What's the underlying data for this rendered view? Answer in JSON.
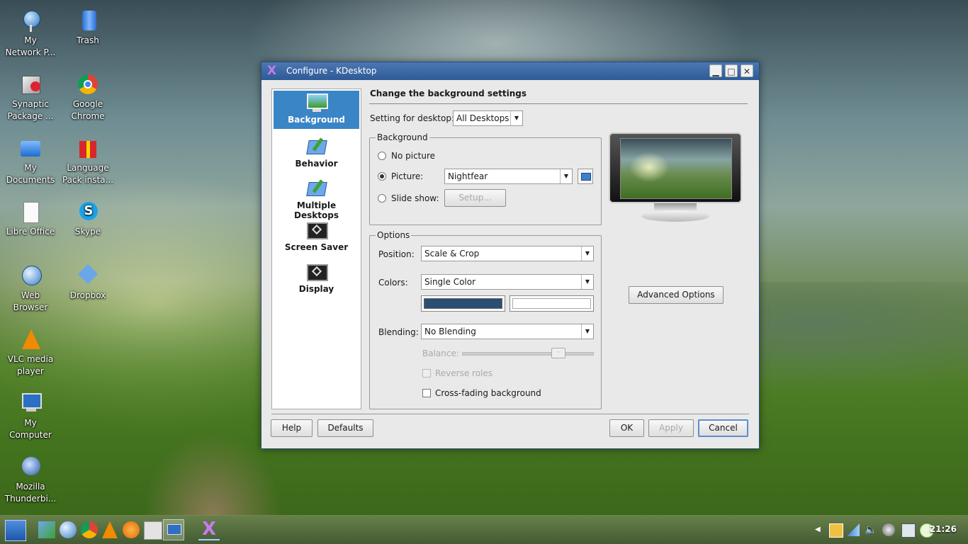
{
  "desktop": {
    "icons": [
      {
        "label1": "My",
        "label2": "Network P..."
      },
      {
        "label1": "Trash",
        "label2": ""
      },
      {
        "label1": "Synaptic",
        "label2": "Package ..."
      },
      {
        "label1": "Google",
        "label2": "Chrome"
      },
      {
        "label1": "My",
        "label2": "Documents"
      },
      {
        "label1": "Language",
        "label2": "Pack insta..."
      },
      {
        "label1": "Libre Office",
        "label2": ""
      },
      {
        "label1": "Skype",
        "label2": ""
      },
      {
        "label1": "Web",
        "label2": "Browser"
      },
      {
        "label1": "Dropbox",
        "label2": ""
      },
      {
        "label1": "VLC media",
        "label2": "player"
      },
      {
        "label1": "My",
        "label2": "Computer"
      },
      {
        "label1": "Mozilla",
        "label2": "Thunderbi..."
      }
    ]
  },
  "window": {
    "title": "Configure - KDesktop",
    "logo": "X",
    "controls": {
      "minimize": "▁",
      "maximize": "□",
      "close": "✕"
    }
  },
  "sidebar": {
    "items": [
      {
        "label": "Background"
      },
      {
        "label": "Behavior"
      },
      {
        "label": "Multiple Desktops"
      },
      {
        "label": "Screen Saver"
      },
      {
        "label": "Display"
      }
    ]
  },
  "content": {
    "heading": "Change the background settings",
    "setting_for_label": "Setting for desktop:",
    "setting_for_value": "All Desktops",
    "background_group": {
      "title": "Background",
      "no_picture": "No picture",
      "picture": "Picture:",
      "picture_value": "Nightfear",
      "slide_show": "Slide show:",
      "setup": "Setup..."
    },
    "options_group": {
      "title": "Options",
      "position_label": "Position:",
      "position_value": "Scale & Crop",
      "colors_label": "Colors:",
      "colors_value": "Single Color",
      "color1": "#2b4f73",
      "color2": "#ffffff",
      "blending_label": "Blending:",
      "blending_value": "No Blending",
      "balance_label": "Balance:",
      "balance_handle": "··",
      "reverse_roles": "Reverse roles",
      "cross_fading": "Cross-fading background"
    },
    "advanced_options": "Advanced Options"
  },
  "footer": {
    "help": "Help",
    "defaults": "Defaults",
    "ok": "OK",
    "apply": "Apply",
    "cancel": "Cancel"
  },
  "taskbar": {
    "launcher": "X",
    "clock": "21:26"
  }
}
